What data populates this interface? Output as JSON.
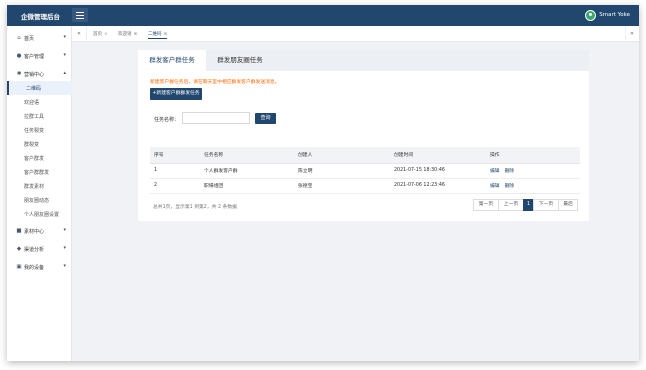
{
  "app": {
    "title": "企微管理后台",
    "username": "Smart Yoke"
  },
  "sidebar": {
    "items": [
      {
        "label": "首页",
        "icon": "home-icon"
      },
      {
        "label": "客户管理",
        "icon": "user-icon"
      },
      {
        "label": "营销中心",
        "icon": "gear-icon"
      },
      {
        "label": "素材中心",
        "icon": "folder-icon"
      },
      {
        "label": "渠道分析",
        "icon": "chart-icon"
      },
      {
        "label": "我的设备",
        "icon": "device-icon"
      }
    ],
    "marketing_sub": [
      "二维码",
      "欢迎语",
      "拉群工具",
      "任务裂变",
      "群裂变",
      "客户群发",
      "客户群群发",
      "群发素材",
      "朋友圈动态",
      "个人朋友圈设置"
    ]
  },
  "tabs": [
    {
      "label": "首页",
      "close": "×"
    },
    {
      "label": "欢迎语",
      "close": "⊗"
    },
    {
      "label": "二维码",
      "close": "⊗"
    }
  ],
  "panel": {
    "tabs": [
      "群发客户群任务",
      "群发朋友圈任务"
    ],
    "notice": "新建客户群任务后，请在聊天室中相应群发客户群发送消息。",
    "new_button": "+新建客户群群发任务",
    "search_label": "任务名称：",
    "search_placeholder": "",
    "search_button": "查询"
  },
  "table": {
    "headers": [
      "序号",
      "任务名称",
      "创建人",
      "创建时间",
      "操作"
    ],
    "rows": [
      {
        "no": "1",
        "name": "个人群发客户群",
        "creator": "陈立明",
        "time": "2021-07-15 18:30:46",
        "edit": "编辑",
        "delete": "删除"
      },
      {
        "no": "2",
        "name": "职場组团",
        "creator": "张德宝",
        "time": "2021-07-06 12:23:46",
        "edit": "编辑",
        "delete": "删除"
      }
    ]
  },
  "pagination": {
    "info": "总共1页，显示第1 到第2，共 2 条数据",
    "first": "第一页",
    "prev": "上一页",
    "current": "1",
    "next": "下一页",
    "last": "最后"
  },
  "colors": {
    "primary": "#21476e",
    "notice": "#ff6a00"
  }
}
